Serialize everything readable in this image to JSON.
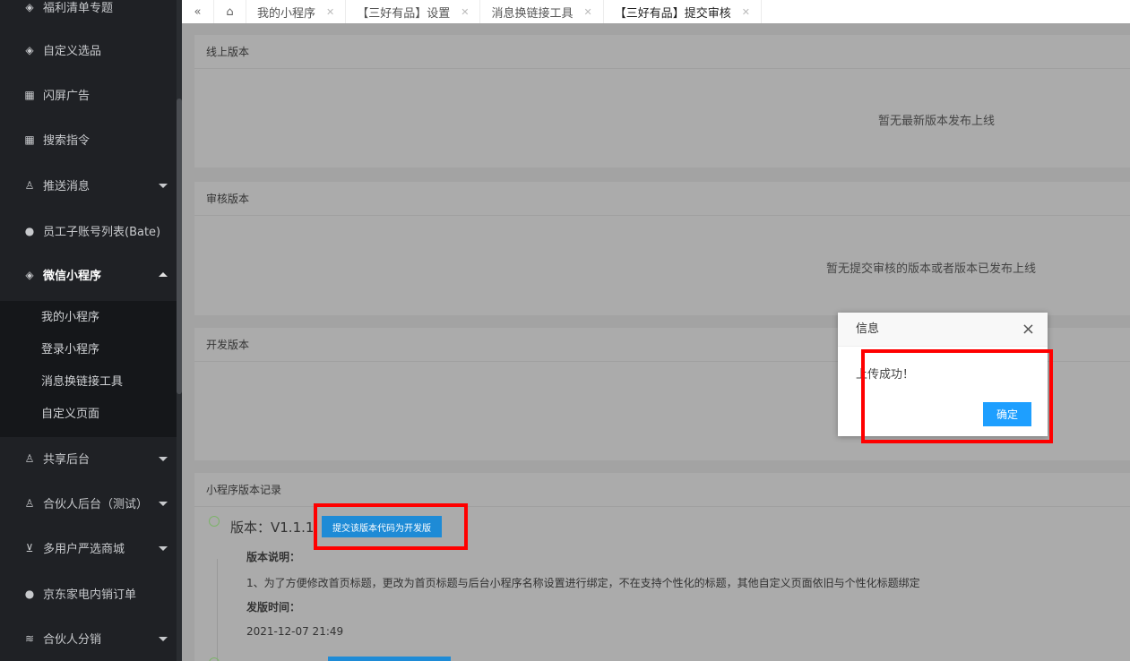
{
  "sidebar": {
    "items": [
      {
        "label": "福利清单专题",
        "icon": "cube-icon"
      },
      {
        "label": "自定义选品",
        "icon": "cube-icon"
      },
      {
        "label": "闪屏广告",
        "icon": "grid-icon"
      },
      {
        "label": "搜索指令",
        "icon": "grid-icon"
      },
      {
        "label": "推送消息",
        "icon": "user-icon"
      },
      {
        "label": "员工子账号列表(Bate)",
        "icon": "globe-icon"
      },
      {
        "label": "微信小程序",
        "icon": "cube-icon"
      },
      {
        "label": "共享后台",
        "icon": "user-icon"
      },
      {
        "label": "合伙人后台（测试）",
        "icon": "user-icon"
      },
      {
        "label": "多用户严选商城",
        "icon": "cart-icon"
      },
      {
        "label": "京东家电内销订单",
        "icon": "globe-icon"
      },
      {
        "label": "合伙人分销",
        "icon": "layers-icon"
      }
    ],
    "submenu": [
      "我的小程序",
      "登录小程序",
      "消息换链接工具",
      "自定义页面"
    ]
  },
  "tabs": {
    "collapse_icon": "«",
    "home_icon": "⌂",
    "items": [
      {
        "label": "我的小程序"
      },
      {
        "label": "【三好有品】设置"
      },
      {
        "label": "消息换链接工具"
      },
      {
        "label": "【三好有品】提交审核"
      }
    ]
  },
  "panels": {
    "online": {
      "title": "线上版本",
      "empty": "暂无最新版本发布上线"
    },
    "review": {
      "title": "审核版本",
      "empty": "暂无提交审核的版本或者版本已发布上线"
    },
    "dev": {
      "title": "开发版本"
    },
    "records": {
      "title": "小程序版本记录",
      "version": "版本：V1.1.1",
      "submit_button": "提交该版本代码为开发版",
      "desc_label": "版本说明：",
      "desc": "1、为了方便修改首页标题，更改为首页标题与后台小程序名称设置进行绑定，不在支持个性化的标题，其他自定义页面依旧与个性化标题绑定",
      "time_label": "发版时间：",
      "time": "2021-12-07 21:49"
    }
  },
  "dialog": {
    "title": "信息",
    "close": "×",
    "message": "上传成功！",
    "ok": "确定"
  },
  "colors": {
    "sidebar_bg": "#1f2125",
    "highlight": "#ff0000",
    "primary_button": "#1e9fff"
  }
}
